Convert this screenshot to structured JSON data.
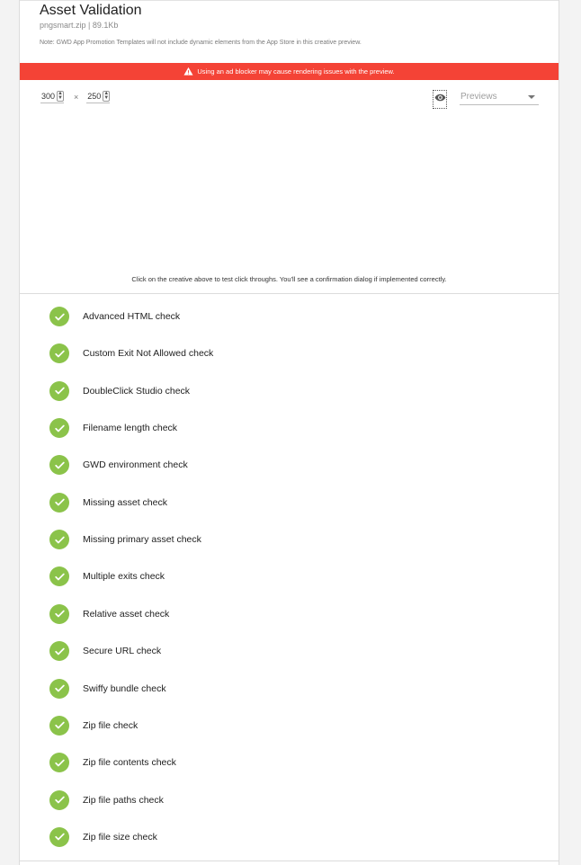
{
  "header": {
    "title": "Asset Validation",
    "file_info": "pngsmart.zip | 89.1Kb",
    "note": "Note: GWD App Promotion Templates will not include dynamic elements from the App Store in this creative preview."
  },
  "banner": {
    "text": "Using an ad blocker may cause rendering issues with the preview.",
    "color": "#f44336"
  },
  "dimensions": {
    "width_value": "300",
    "height_value": "250",
    "separator": "×"
  },
  "preview_select": {
    "placeholder": "Previews"
  },
  "preview_hint": "Click on the creative above to test click throughs. You'll see a confirmation dialog if implemented correctly.",
  "checks": [
    {
      "label": "Advanced HTML check",
      "status": "passed"
    },
    {
      "label": "Custom Exit Not Allowed check",
      "status": "passed"
    },
    {
      "label": "DoubleClick Studio check",
      "status": "passed"
    },
    {
      "label": "Filename length check",
      "status": "passed"
    },
    {
      "label": "GWD environment check",
      "status": "passed"
    },
    {
      "label": "Missing asset check",
      "status": "passed"
    },
    {
      "label": "Missing primary asset check",
      "status": "passed"
    },
    {
      "label": "Multiple exits check",
      "status": "passed"
    },
    {
      "label": "Relative asset check",
      "status": "passed"
    },
    {
      "label": "Secure URL check",
      "status": "passed"
    },
    {
      "label": "Swiffy bundle check",
      "status": "passed"
    },
    {
      "label": "Zip file check",
      "status": "passed"
    },
    {
      "label": "Zip file contents check",
      "status": "passed"
    },
    {
      "label": "Zip file paths check",
      "status": "passed"
    },
    {
      "label": "Zip file size check",
      "status": "passed"
    }
  ],
  "colors": {
    "check_green": "#8bc34a",
    "banner_red": "#f44336"
  }
}
